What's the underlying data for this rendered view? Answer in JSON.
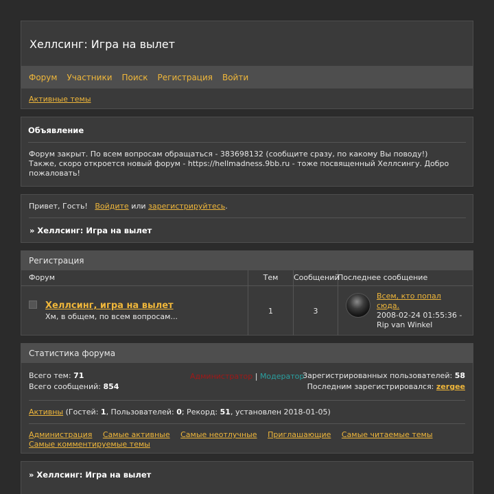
{
  "header": {
    "title": "Хеллсинг: Игра на вылет",
    "nav": [
      "Форум",
      "Участники",
      "Поиск",
      "Регистрация",
      "Войти"
    ],
    "sub_link": "Активные темы"
  },
  "announcement": {
    "heading": "Объявление",
    "line1": "Форум закрыт. По всем вопросам обращаться - 383698132 (сообщите сразу, по какому Вы поводу!)",
    "line2": "Также, скоро откроется новый форум - https://hellmadness.9bb.ru - тоже посвященный Хеллсингу. Добро пожаловать!"
  },
  "welcome": {
    "greeting": "Привет, Гость!",
    "login_link": "Войдите",
    "or_text": "или",
    "register_link": "зарегистрируйтесь",
    "period": ".",
    "crumb": "» Хеллсинг: Игра на вылет"
  },
  "category": {
    "title": "Регистрация",
    "columns": {
      "forum": "Форум",
      "topics": "Тем",
      "posts": "Сообщений",
      "last": "Последнее сообщение"
    },
    "forum": {
      "name": "Хеллсинг, игра на вылет",
      "description": "Хм, в общем, по всем вопросам...",
      "topics": "1",
      "posts": "3",
      "last_topic": "Всем, кто попал сюда.",
      "last_date": "2008-02-24 01:55:36 -",
      "last_author": "Rip van Winkel"
    }
  },
  "stats": {
    "title": "Статистика форума",
    "total_topics_label": "Всего тем:",
    "total_topics": "71",
    "total_posts_label": "Всего сообщений:",
    "total_posts": "854",
    "admin_label": "Администратор",
    "sep": "|",
    "mod_label": "Модератор",
    "registered_label": "Зарегистрированных пользователей:",
    "registered": "58",
    "last_reg_label": "Последним зарегистрировался:",
    "last_reg": "zergee",
    "online_link": "Активны",
    "online_guests_label": "(Гостей:",
    "online_guests": "1",
    "online_users_label": ", Пользователей:",
    "online_users": "0",
    "online_record_label": "; Рекорд:",
    "online_record": "51",
    "online_tail": ", установлен 2018-01-05)",
    "links": [
      "Администрация",
      "Самые активные",
      "Самые неотлучные",
      "Приглашающие",
      "Самые читаемые темы",
      "Самые комментируемые темы"
    ]
  },
  "footer": {
    "crumb": "» Хеллсинг: Игра на вылет"
  },
  "colors": {
    "background": "#2b2b2b",
    "panel": "#3a3a3a",
    "accent": "#f0b73a",
    "admin": "#a01818",
    "moderator": "#2aa0a0"
  }
}
